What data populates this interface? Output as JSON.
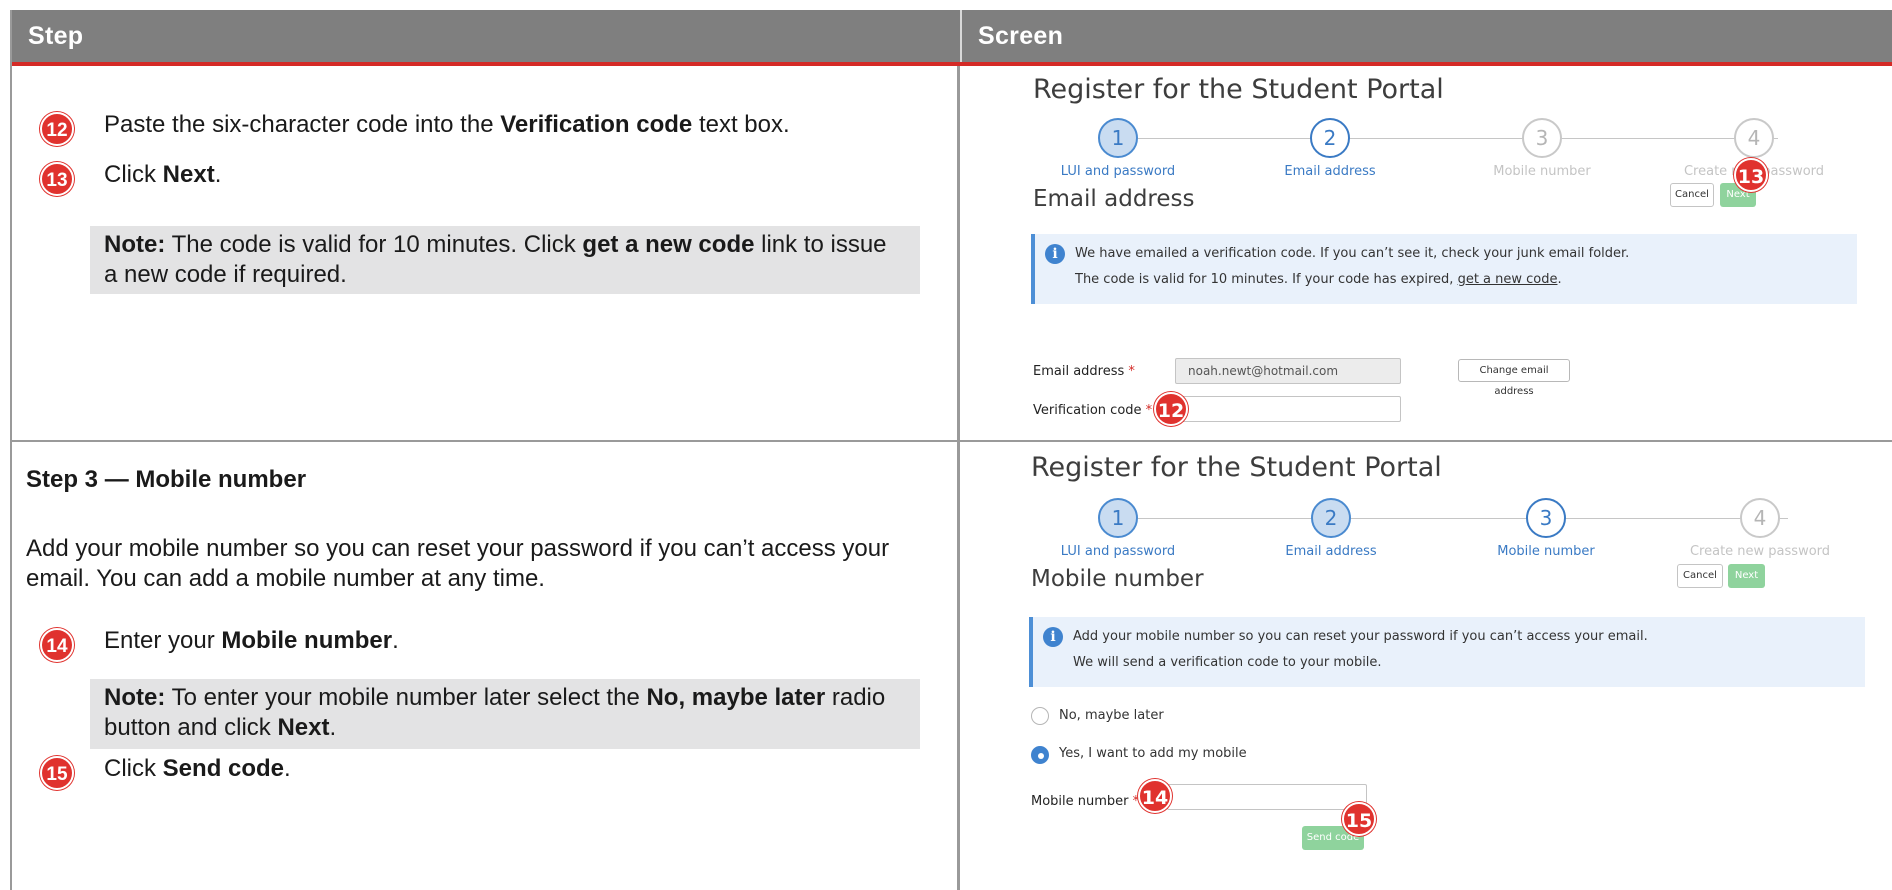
{
  "header": {
    "step": "Step",
    "screen": "Screen"
  },
  "row1": {
    "item12": {
      "badge": "12",
      "pre": "Paste the six-character code into the ",
      "bold": "Verification code",
      "post": " text box."
    },
    "item13": {
      "badge": "13",
      "pre": "Click ",
      "bold": "Next",
      "post": "."
    },
    "note": {
      "label": "Note:",
      "pre": " The code is valid for 10 minutes. Click ",
      "bold": "get a new code",
      "post": " link to issue a new code if required."
    }
  },
  "row2": {
    "heading": "Step 3 — Mobile number",
    "paragraph": "Add your mobile number so you can reset your password if you can’t access your email. You can add a mobile number at any time.",
    "item14": {
      "badge": "14",
      "pre": "Enter your ",
      "bold": "Mobile number",
      "post": "."
    },
    "note": {
      "label": "Note:",
      "pre": " To enter your mobile number later select the ",
      "bold1": "No, maybe later",
      "mid": " radio button and click ",
      "bold2": "Next",
      "post": "."
    },
    "item15": {
      "badge": "15",
      "pre": "Click ",
      "bold": "Send code",
      "post": "."
    }
  },
  "screen1": {
    "title": "Register for the Student Portal",
    "steps": [
      {
        "num": "1",
        "label": "LUI and password",
        "state": "done"
      },
      {
        "num": "2",
        "label": "Email address",
        "state": "active"
      },
      {
        "num": "3",
        "label": "Mobile number",
        "state": "todo"
      },
      {
        "num": "4",
        "label": "Create new password",
        "state": "todo"
      }
    ],
    "subtitle": "Email address",
    "cancel": "Cancel",
    "next": "Next",
    "callout13": "13",
    "info_line1": "We have emailed a verification code. If you can’t see it, check your junk email folder.",
    "info_line2_pre": "The code is valid for 10 minutes. If your code has expired, ",
    "info_link": "get a new code",
    "info_line2_post": ".",
    "email_label": "Email address",
    "email_value": "noah.newt@hotmail.com",
    "change_email": "Change email address",
    "verif_label": "Verification code",
    "callout12": "12",
    "required": "*"
  },
  "screen2": {
    "title": "Register for the Student Portal",
    "steps": [
      {
        "num": "1",
        "label": "LUI and password",
        "state": "done"
      },
      {
        "num": "2",
        "label": "Email address",
        "state": "done"
      },
      {
        "num": "3",
        "label": "Mobile number",
        "state": "active"
      },
      {
        "num": "4",
        "label": "Create new password",
        "state": "todo"
      }
    ],
    "subtitle": "Mobile number",
    "cancel": "Cancel",
    "next": "Next",
    "info_line1": "Add your mobile number so you can reset your password if you can’t access your email.",
    "info_line2": "We will send a verification code to your mobile.",
    "radio_no": "No, maybe later",
    "radio_yes": "Yes, I want to add my mobile",
    "mobile_label": "Mobile number",
    "callout14": "14",
    "send_code": "Send code",
    "callout15": "15",
    "required": "*"
  }
}
